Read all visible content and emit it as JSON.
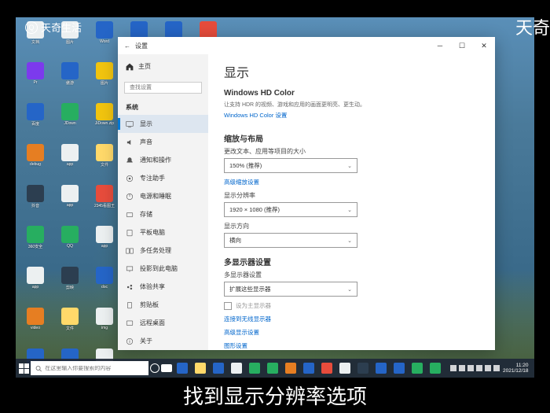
{
  "watermarks": {
    "top_left": "天奇生活",
    "top_right": "天奇"
  },
  "subtitle": "找到显示分辨率选项",
  "settings_window": {
    "title": "设置",
    "sidebar": {
      "home": "主页",
      "search_placeholder": "查找设置",
      "section": "系统",
      "items": [
        {
          "icon": "display",
          "label": "显示",
          "active": true
        },
        {
          "icon": "sound",
          "label": "声音"
        },
        {
          "icon": "notifications",
          "label": "通知和操作"
        },
        {
          "icon": "focus",
          "label": "专注助手"
        },
        {
          "icon": "power",
          "label": "电源和睡眠"
        },
        {
          "icon": "storage",
          "label": "存储"
        },
        {
          "icon": "tablet",
          "label": "平板电脑"
        },
        {
          "icon": "multitask",
          "label": "多任务处理"
        },
        {
          "icon": "project",
          "label": "投影到此电脑"
        },
        {
          "icon": "shared",
          "label": "体验共享"
        },
        {
          "icon": "clipboard",
          "label": "剪贴板"
        },
        {
          "icon": "remote",
          "label": "远程桌面"
        },
        {
          "icon": "about",
          "label": "关于"
        }
      ]
    },
    "content": {
      "title": "显示",
      "hdcolor_heading": "Windows HD Color",
      "hdcolor_desc": "让支持 HDR 的视频、游戏和应用的画面更明亮、更生动。",
      "hdcolor_link": "Windows HD Color 设置",
      "scale_heading": "缩放与布局",
      "scale_label": "更改文本、应用等项目的大小",
      "scale_value": "150% (推荐)",
      "scale_link": "高级缩放设置",
      "resolution_label": "显示分辨率",
      "resolution_value": "1920 × 1080 (推荐)",
      "orientation_label": "显示方向",
      "orientation_value": "横向",
      "multi_heading": "多显示器设置",
      "multi_label": "多显示器设置",
      "multi_value": "扩展这些显示器",
      "multi_checkbox": "设为主显示器",
      "wireless_link": "连接到无线显示器",
      "advanced_link": "高级显示设置",
      "graphics_link": "图形设置"
    }
  },
  "taskbar": {
    "search_placeholder": "在这里输入你要搜索的内容",
    "time": "11:20",
    "date": "2021/12/18"
  }
}
